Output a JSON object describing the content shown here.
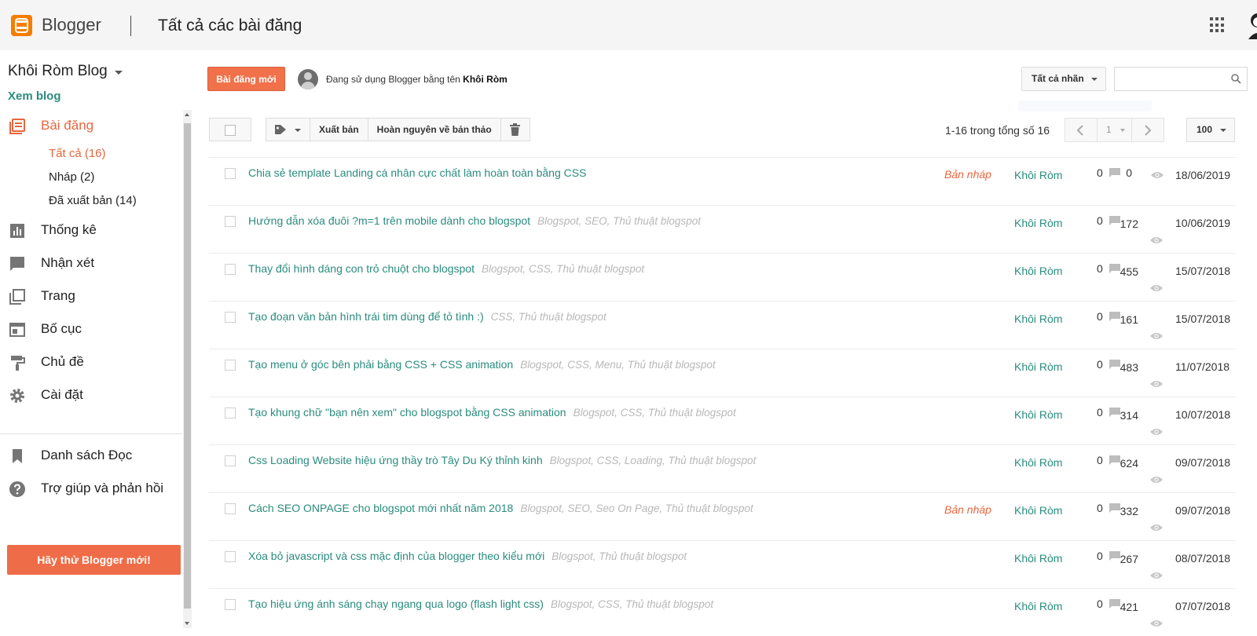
{
  "header": {
    "brand": "Blogger",
    "page_title": "Tất cả các bài đăng"
  },
  "sidebar": {
    "blog_name": "Khôi Ròm Blog",
    "view_blog": "Xem blog",
    "posts_label": "Bài đăng",
    "sub_items": [
      "Tất cả (16)",
      "Nháp (2)",
      "Đã xuất bản (14)"
    ],
    "nav": [
      {
        "label": "Thống kê",
        "icon": "stats-icon"
      },
      {
        "label": "Nhận xét",
        "icon": "comments-icon"
      },
      {
        "label": "Trang",
        "icon": "pages-icon"
      },
      {
        "label": "Bố cục",
        "icon": "layout-icon"
      },
      {
        "label": "Chủ đề",
        "icon": "theme-icon"
      },
      {
        "label": "Cài đặt",
        "icon": "settings-icon"
      }
    ],
    "bottom_nav": [
      {
        "label": "Danh sách Đọc",
        "icon": "bookmark-icon"
      },
      {
        "label": "Trợ giúp và phản hồi",
        "icon": "help-icon"
      }
    ],
    "try_button": "Hãy thử Blogger mới!"
  },
  "actions": {
    "new_post": "Bài đăng mới",
    "using_as": "Đang sử dụng Blogger bằng tên",
    "user_name": "Khôi Ròm",
    "labels_filter": "Tất cả nhãn",
    "search_placeholder": ""
  },
  "toolbar": {
    "publish": "Xuất bản",
    "revert": "Hoàn nguyên về bản thảo",
    "range": "1-16 trong tổng số 16",
    "page": "1",
    "per_page": "100"
  },
  "colors": {
    "accent": "#e8663d",
    "link": "#2a8c7d",
    "brand_orange": "#f57d00"
  },
  "posts": [
    {
      "title": "Chia sẻ template Landing cá nhân cực chất làm hoàn toàn bằng CSS",
      "labels": "",
      "draft": "Bản nháp",
      "author": "Khôi Ròm",
      "comments": "0",
      "views": "0",
      "date": "18/06/2019"
    },
    {
      "title": "Hướng dẫn xóa đuôi ?m=1 trên mobile dành cho blogspot",
      "labels": "Blogspot, SEO, Thủ thuật blogspot",
      "draft": "",
      "author": "Khôi Ròm",
      "comments": "0",
      "views": "172",
      "date": "10/06/2019"
    },
    {
      "title": "Thay đổi hình dáng con trỏ chuột cho blogspot",
      "labels": "Blogspot, CSS, Thủ thuật blogspot",
      "draft": "",
      "author": "Khôi Ròm",
      "comments": "0",
      "views": "455",
      "date": "15/07/2018"
    },
    {
      "title": "Tạo đoạn văn bản hình trái tim dùng để tỏ tình :)",
      "labels": "CSS, Thủ thuật blogspot",
      "draft": "",
      "author": "Khôi Ròm",
      "comments": "0",
      "views": "161",
      "date": "15/07/2018"
    },
    {
      "title": "Tạo menu ở góc bên phải bằng CSS + CSS animation",
      "labels": "Blogspot, CSS, Menu, Thủ thuật blogspot",
      "draft": "",
      "author": "Khôi Ròm",
      "comments": "0",
      "views": "483",
      "date": "11/07/2018"
    },
    {
      "title": "Tạo khung chữ \"bạn nên xem\" cho blogspot bằng CSS animation",
      "labels": "Blogspot, CSS, Thủ thuật blogspot",
      "draft": "",
      "author": "Khôi Ròm",
      "comments": "0",
      "views": "314",
      "date": "10/07/2018"
    },
    {
      "title": "Css Loading Website hiệu ứng thầy trò Tây Du Ký thỉnh kinh",
      "labels": "Blogspot, CSS, Loading, Thủ thuật blogspot",
      "draft": "",
      "author": "Khôi Ròm",
      "comments": "0",
      "views": "624",
      "date": "09/07/2018"
    },
    {
      "title": "Cách SEO ONPAGE cho blogspot mới nhất năm 2018",
      "labels": "Blogspot, SEO, Seo On Page, Thủ thuật blogspot",
      "draft": "Bản nháp",
      "author": "Khôi Ròm",
      "comments": "0",
      "views": "332",
      "date": "09/07/2018"
    },
    {
      "title": "Xóa bỏ javascript và css mặc định của blogger theo kiểu mới",
      "labels": "Blogspot, Thủ thuật blogspot",
      "draft": "",
      "author": "Khôi Ròm",
      "comments": "0",
      "views": "267",
      "date": "08/07/2018"
    },
    {
      "title": "Tạo hiệu ứng ánh sáng chạy ngang qua logo (flash light css)",
      "labels": "Blogspot, CSS, Thủ thuật blogspot",
      "draft": "",
      "author": "Khôi Ròm",
      "comments": "0",
      "views": "421",
      "date": "07/07/2018"
    }
  ]
}
